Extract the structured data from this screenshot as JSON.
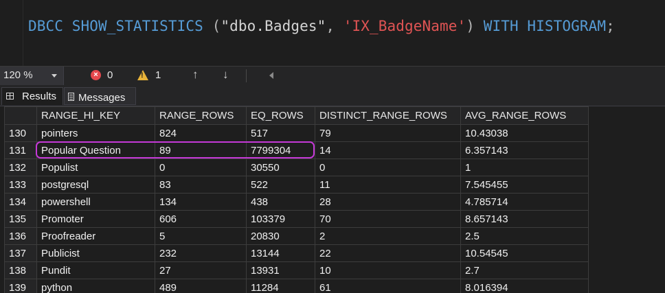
{
  "editor": {
    "code": {
      "kw1": "DBCC",
      "fn": "SHOW_STATISTICS",
      "open_paren": " (",
      "table_str": "\"dbo.Badges\"",
      "comma": ", ",
      "index_str": "'IX_BadgeName'",
      "close_paren": ")",
      "kw2": " WITH HISTOGRAM",
      "semicolon": ";"
    }
  },
  "statusbar": {
    "zoom": "120 %",
    "errors_count": "0",
    "error_icon_glyph": "×",
    "warnings_count": "1",
    "warning_icon_glyph": "!",
    "up_arrow": "↑",
    "down_arrow": "↓"
  },
  "tabs": {
    "results": "Results",
    "messages": "Messages"
  },
  "grid": {
    "columns": [
      "RANGE_HI_KEY",
      "RANGE_ROWS",
      "EQ_ROWS",
      "DISTINCT_RANGE_ROWS",
      "AVG_RANGE_ROWS"
    ],
    "rows": [
      {
        "num": "130",
        "cells": [
          "pointers",
          "824",
          "517",
          "79",
          "10.43038"
        ]
      },
      {
        "num": "131",
        "cells": [
          "Popular Question",
          "89",
          "7799304",
          "14",
          "6.357143"
        ]
      },
      {
        "num": "132",
        "cells": [
          "Populist",
          "0",
          "30550",
          "0",
          "1"
        ]
      },
      {
        "num": "133",
        "cells": [
          "postgresql",
          "83",
          "522",
          "11",
          "7.545455"
        ]
      },
      {
        "num": "134",
        "cells": [
          "powershell",
          "134",
          "438",
          "28",
          "4.785714"
        ]
      },
      {
        "num": "135",
        "cells": [
          "Promoter",
          "606",
          "103379",
          "70",
          "8.657143"
        ]
      },
      {
        "num": "136",
        "cells": [
          "Proofreader",
          "5",
          "20830",
          "2",
          "2.5"
        ]
      },
      {
        "num": "137",
        "cells": [
          "Publicist",
          "232",
          "13144",
          "22",
          "10.54545"
        ]
      },
      {
        "num": "138",
        "cells": [
          "Pundit",
          "27",
          "13931",
          "10",
          "2.7"
        ]
      },
      {
        "num": "139",
        "cells": [
          "python",
          "489",
          "11284",
          "61",
          "8.016394"
        ]
      }
    ],
    "highlight_color": "#c639d8"
  }
}
